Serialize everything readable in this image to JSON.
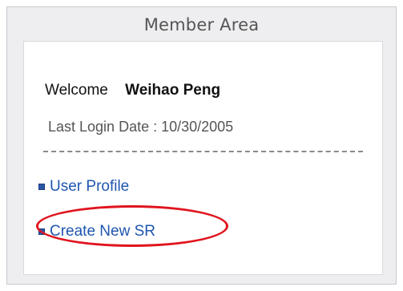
{
  "panel": {
    "title": "Member Area"
  },
  "welcome": {
    "label": "Welcome",
    "user_name": "Weihao Peng"
  },
  "last_login": {
    "text": "Last Login Date : 10/30/2005"
  },
  "links": {
    "user_profile": "User Profile",
    "create_new_sr": "Create New SR"
  },
  "colors": {
    "panel_background": "#eeeef0",
    "link": "#1f56b0",
    "highlight": "#e0141e"
  }
}
